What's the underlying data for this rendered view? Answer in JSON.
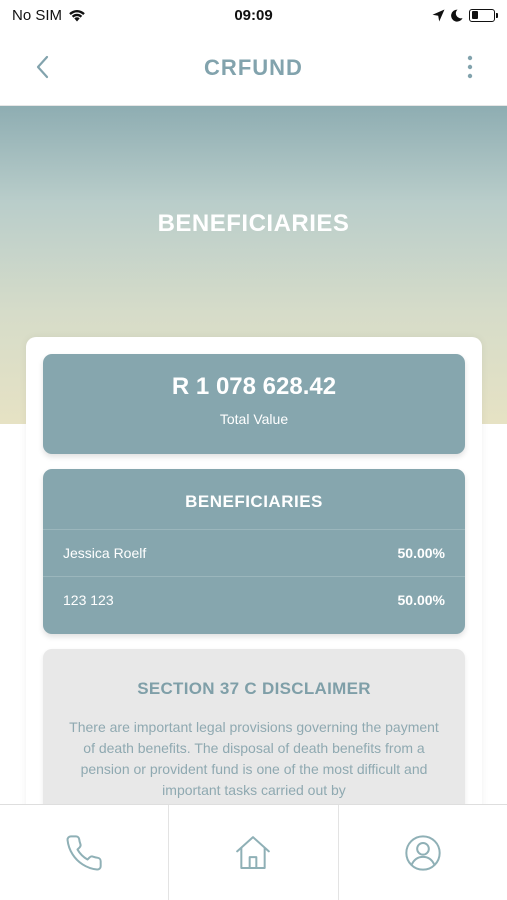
{
  "status_bar": {
    "carrier": "No SIM",
    "time": "09:09",
    "icons": [
      "wifi-icon",
      "location-arrow-icon",
      "moon-icon",
      "battery-icon"
    ]
  },
  "nav": {
    "title": "CRFUND",
    "back_icon": "chevron-left-icon",
    "more_icon": "more-vertical-icon"
  },
  "hero": {
    "title": "BENEFICIARIES"
  },
  "total": {
    "amount": "R 1 078 628.42",
    "label": "Total Value"
  },
  "beneficiaries": {
    "title": "BENEFICIARIES",
    "rows": [
      {
        "name": "Jessica Roelf",
        "percent": "50.00%"
      },
      {
        "name": "123 123",
        "percent": "50.00%"
      }
    ]
  },
  "disclaimer": {
    "title": "SECTION 37 C DISCLAIMER",
    "text": "There are important legal provisions governing the payment of death benefits. The disposal of death benefits from a pension or provident fund is one of the most difficult and important tasks carried out by"
  },
  "tabs": [
    {
      "icon": "phone-icon"
    },
    {
      "icon": "home-icon"
    },
    {
      "icon": "user-profile-icon"
    }
  ],
  "colors": {
    "accent": "#82a3ad",
    "panel": "#86a6ae",
    "icon": "#8fb0b6"
  }
}
